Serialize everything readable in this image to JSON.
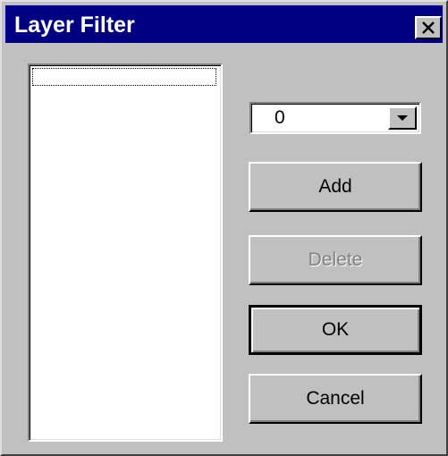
{
  "window": {
    "title": "Layer Filter",
    "close_icon": "close-icon",
    "title_bar_color": "#000080",
    "face_color": "#c0c0c0"
  },
  "layer_list": {
    "items": []
  },
  "layer_dropdown": {
    "selected_value": "0",
    "arrow_icon": "chevron-down-icon"
  },
  "buttons": {
    "add_label": "Add",
    "delete_label": "Delete",
    "delete_enabled": false,
    "ok_label": "OK",
    "ok_is_default": true,
    "cancel_label": "Cancel"
  }
}
